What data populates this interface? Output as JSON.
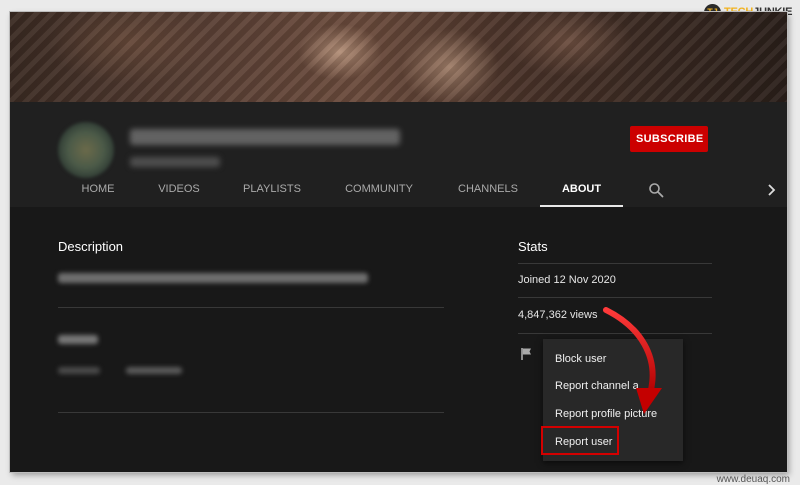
{
  "logo": {
    "prefix": "TECH",
    "suffix": "JUNKIE",
    "badge": "TJ"
  },
  "channel": {
    "subscribe_label": "SUBSCRIBE"
  },
  "tabs": [
    {
      "label": "HOME",
      "active": false
    },
    {
      "label": "VIDEOS",
      "active": false
    },
    {
      "label": "PLAYLISTS",
      "active": false
    },
    {
      "label": "COMMUNITY",
      "active": false
    },
    {
      "label": "CHANNELS",
      "active": false
    },
    {
      "label": "ABOUT",
      "active": true
    }
  ],
  "icons": {
    "search": "search-icon",
    "next": "chevron-right-icon",
    "flag": "flag-icon"
  },
  "about": {
    "description_heading": "Description",
    "stats_heading": "Stats",
    "joined": "Joined 12 Nov 2020",
    "views": "4,847,362 views"
  },
  "report_menu": {
    "items": [
      "Block user",
      "Report channel a",
      "Report profile picture",
      "Report user"
    ],
    "highlighted": "Report user"
  },
  "colors": {
    "subscribe": "#cc0000",
    "highlight": "#d40000",
    "background": "#181818"
  },
  "watermark": "www.deuaq.com"
}
